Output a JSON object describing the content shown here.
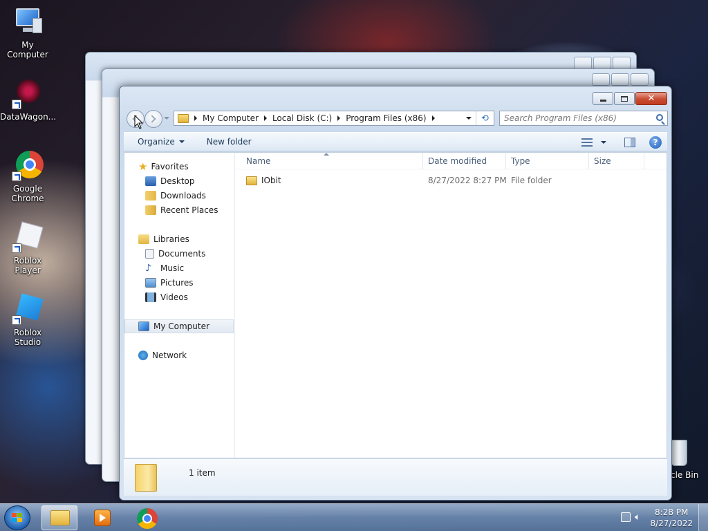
{
  "desktop": {
    "icons": [
      {
        "label": "My Computer"
      },
      {
        "label": "DataWagon..."
      },
      {
        "label": "Google\nChrome"
      },
      {
        "label": "Roblox Player"
      },
      {
        "label": "Roblox Studio"
      },
      {
        "label": "cle Bin"
      }
    ]
  },
  "window": {
    "address": {
      "crumbs": [
        "My Computer",
        "Local Disk (C:)",
        "Program Files (x86)"
      ]
    },
    "search": {
      "placeholder": "Search Program Files (x86)"
    },
    "toolbar": {
      "organize_label": "Organize",
      "new_folder_label": "New folder"
    },
    "nav_pane": {
      "favorites_label": "Favorites",
      "favorites": [
        "Desktop",
        "Downloads",
        "Recent Places"
      ],
      "libraries_label": "Libraries",
      "libraries": [
        "Documents",
        "Music",
        "Pictures",
        "Videos"
      ],
      "computer_label": "My Computer",
      "network_label": "Network"
    },
    "columns": [
      "Name",
      "Date modified",
      "Type",
      "Size"
    ],
    "rows": [
      {
        "name": "IObit",
        "date_modified": "8/27/2022 8:27 PM",
        "type": "File folder",
        "size": ""
      }
    ],
    "details": {
      "item_count": "1 item"
    }
  },
  "taskbar": {
    "clock_time": "8:28 PM",
    "clock_date": "8/27/2022"
  },
  "colors": {
    "accent": "#1a5cc7",
    "close_red": "#c94c32",
    "header_text": "#4c607a"
  }
}
